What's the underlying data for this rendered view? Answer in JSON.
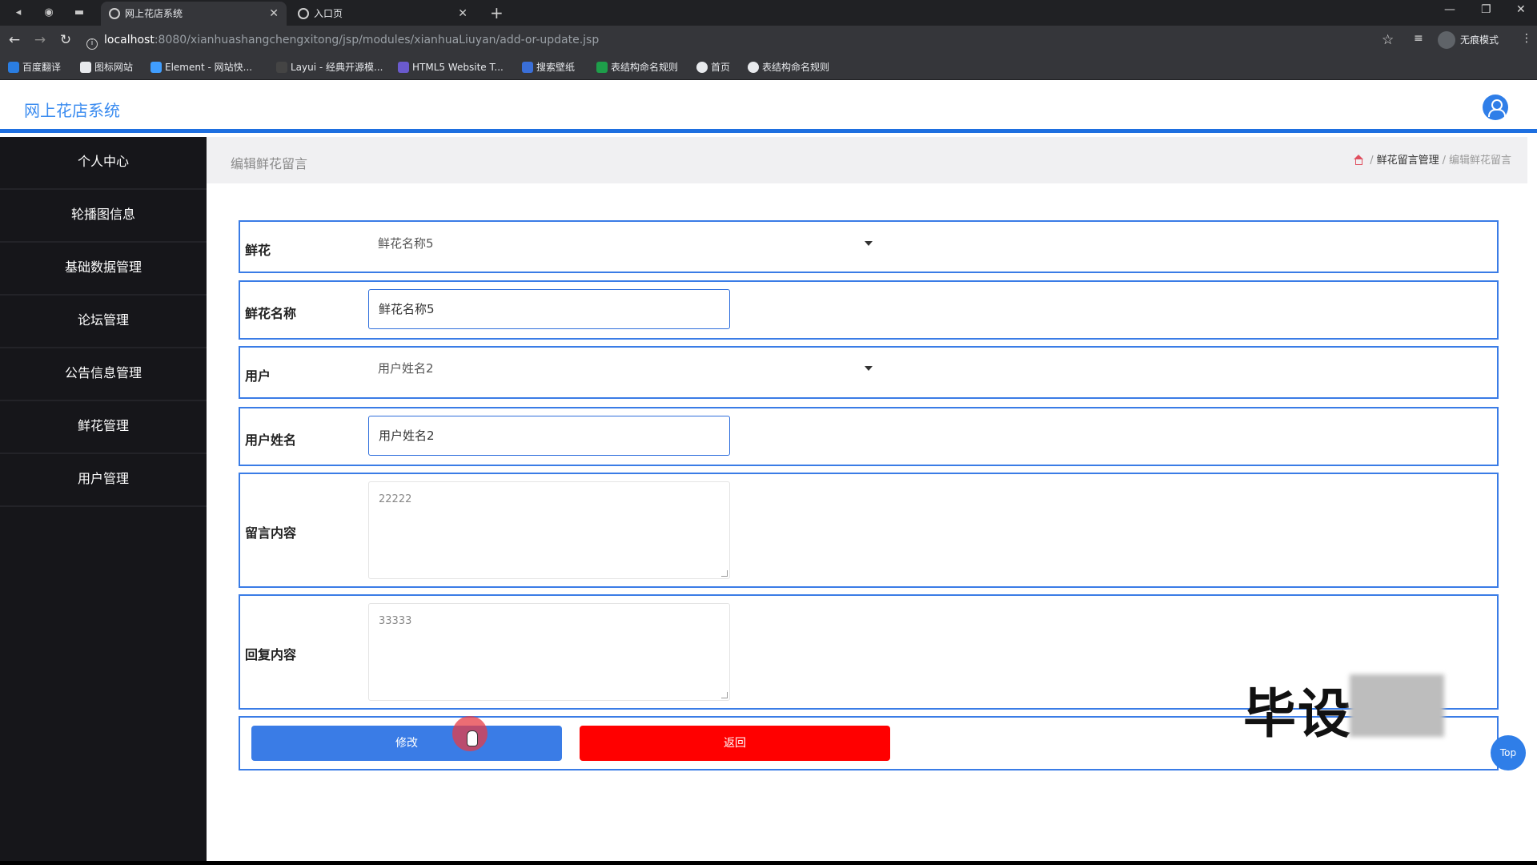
{
  "browser": {
    "tabs": [
      {
        "title": "网上花店系统",
        "active": true
      },
      {
        "title": "入口页",
        "active": false
      }
    ],
    "url_host": "localhost",
    "url_path": ":8080/xianhuashangchengxitong/jsp/modules/xianhuaLiuyan/add-or-update.jsp",
    "profile_label": "无痕模式",
    "bookmarks": [
      "百度翻译",
      "图标网站",
      "Element - 网站快...",
      "Layui - 经典开源模...",
      "HTML5 Website T...",
      "搜索壁纸",
      "表结构命名规则",
      "首页",
      "表结构命名规则"
    ]
  },
  "app": {
    "title": "网上花店系统"
  },
  "sidebar": {
    "items": [
      {
        "label": "个人中心"
      },
      {
        "label": "轮播图信息"
      },
      {
        "label": "基础数据管理"
      },
      {
        "label": "论坛管理"
      },
      {
        "label": "公告信息管理"
      },
      {
        "label": "鲜花管理"
      },
      {
        "label": "用户管理"
      }
    ]
  },
  "header": {
    "page_title": "编辑鲜花留言",
    "breadcrumb": {
      "parent": "鲜花留言管理",
      "current": "编辑鲜花留言"
    }
  },
  "form": {
    "flower": {
      "label": "鲜花",
      "value": "鲜花名称5"
    },
    "flower_name": {
      "label": "鲜花名称",
      "value": "鲜花名称5"
    },
    "user": {
      "label": "用户",
      "value": "用户姓名2"
    },
    "user_name": {
      "label": "用户姓名",
      "value": "用户姓名2"
    },
    "message": {
      "label": "留言内容",
      "value": "22222"
    },
    "reply": {
      "label": "回复内容",
      "value": "33333"
    },
    "save_label": "修改",
    "back_label": "返回"
  },
  "overlay": {
    "watermark": "毕设",
    "top_button": "Top"
  },
  "colors": {
    "primary": "#3a7ce6",
    "danger": "#ff0000",
    "sidebar_bg": "#16161a"
  }
}
